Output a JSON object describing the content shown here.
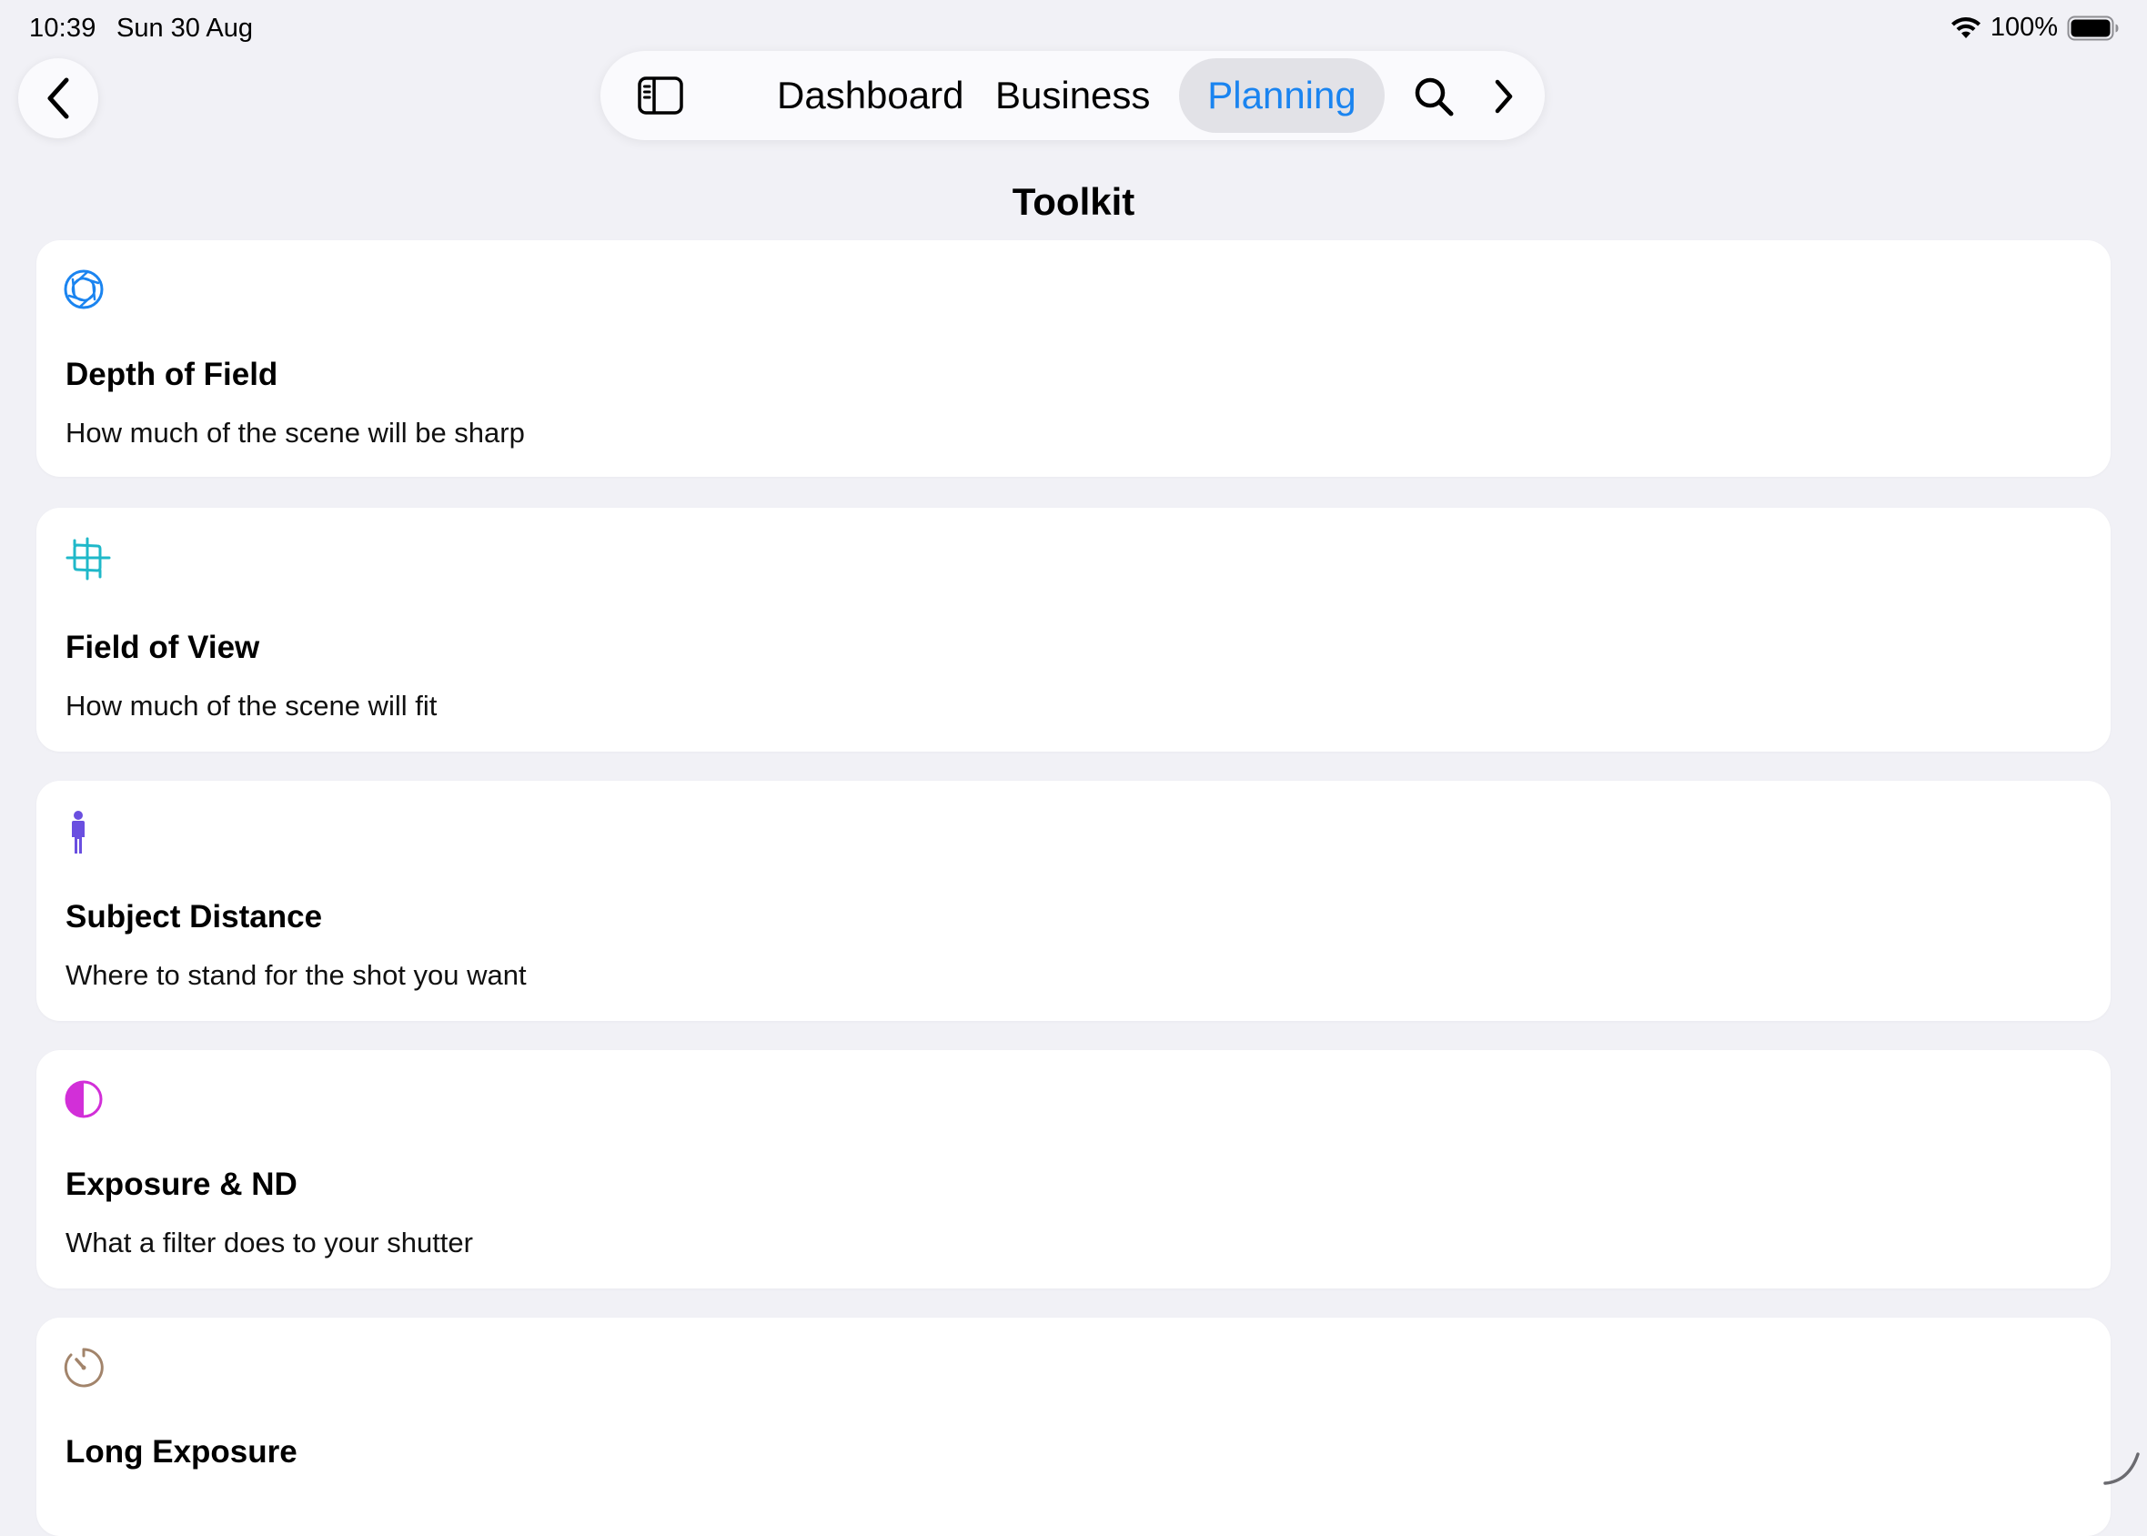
{
  "status_bar": {
    "time": "10:39",
    "date": "Sun 30 Aug",
    "battery_percent": "100%",
    "icons": [
      "wifi-icon",
      "battery-icon"
    ]
  },
  "nav": {
    "back_icon": "chevron-left-icon",
    "sidebar_icon": "sidebar-toggle-icon",
    "tabs": [
      {
        "label": "Dashboard",
        "selected": false
      },
      {
        "label": "Business",
        "selected": false
      },
      {
        "label": "Planning",
        "selected": true
      }
    ],
    "search_icon": "search-icon",
    "next_icon": "chevron-right-icon",
    "accent_color": "#1a84f0"
  },
  "page": {
    "title": "Toolkit"
  },
  "tools": [
    {
      "title": "Depth of Field",
      "subtitle": "How much of the scene will be sharp",
      "icon": "aperture-icon",
      "icon_color": "#1a84f0"
    },
    {
      "title": "Field of View",
      "subtitle": "How much of the scene will fit",
      "icon": "crop-frame-icon",
      "icon_color": "#1fb8c9"
    },
    {
      "title": "Subject Distance",
      "subtitle": "Where to stand for the shot you want",
      "icon": "person-icon",
      "icon_color": "#6a4fe0"
    },
    {
      "title": "Exposure & ND",
      "subtitle": "What a filter does to your shutter",
      "icon": "half-circle-icon",
      "icon_color": "#d22fd8"
    },
    {
      "title": "Long Exposure",
      "subtitle": "",
      "icon": "timer-icon",
      "icon_color": "#a2846b"
    }
  ]
}
